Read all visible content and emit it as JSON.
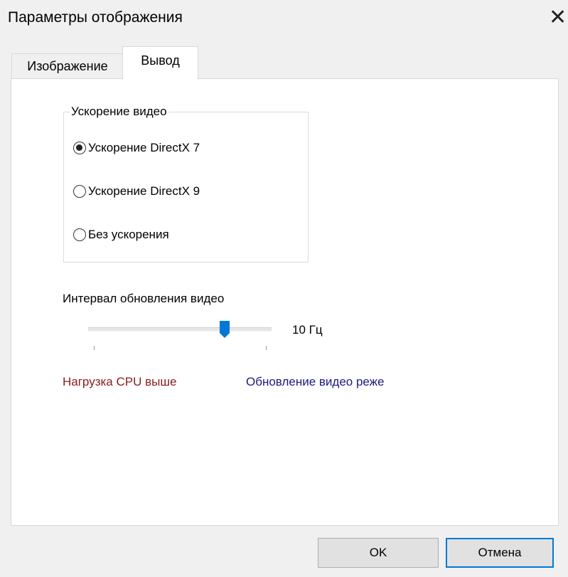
{
  "window": {
    "title": "Параметры отображения",
    "close_glyph": "✕"
  },
  "tabs": [
    {
      "label": "Изображение",
      "active": false
    },
    {
      "label": "Вывод",
      "active": true
    }
  ],
  "video_acceleration": {
    "legend": "Ускорение видео",
    "options": [
      {
        "label": "Ускорение DirectX 7",
        "checked": true
      },
      {
        "label": "Ускорение DirectX 9",
        "checked": false
      },
      {
        "label": "Без ускорения",
        "checked": false
      }
    ]
  },
  "refresh_interval": {
    "label": "Интервал обновления видео",
    "value_text": "10 Гц",
    "position_fraction": 0.76,
    "accent_color": "#0078d7",
    "hint_left": "Нагрузка CPU выше",
    "hint_left_color": "#8b1a1a",
    "hint_right": "Обновление видео реже",
    "hint_right_color": "#1a1a80"
  },
  "buttons": {
    "ok": "OK",
    "cancel": "Отмена"
  }
}
